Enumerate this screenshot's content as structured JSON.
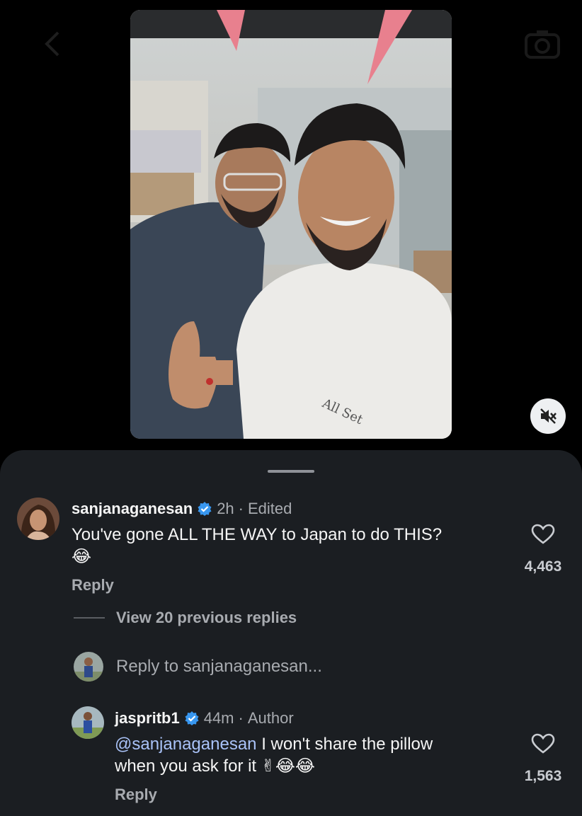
{
  "comments": [
    {
      "username": "sanjanaganesan",
      "verified": true,
      "time": "2h",
      "status": "Edited",
      "text_line1": "You've gone ALL THE WAY to Japan to do THIS?",
      "text_line2_emoji": "😂",
      "reply_label": "Reply",
      "likes": "4,463"
    },
    {
      "username": "jaspritb1",
      "verified": true,
      "time": "44m",
      "status": "Author",
      "mention": "@sanjanaganesan",
      "text_line1_rest": " I won't share the pillow",
      "text_line2": "when you ask for it ",
      "text_line2_emoji": "✌😂😂",
      "reply_label": "Reply",
      "likes": "1,563"
    }
  ],
  "thread": {
    "view_previous": "View 20 previous replies",
    "reply_placeholder": "Reply to sanjanaganesan..."
  },
  "separator": "·",
  "icons": {
    "verified": "verified-badge-icon",
    "like": "heart-icon",
    "mute": "speaker-muted-icon",
    "back": "chevron-left-icon",
    "camera": "camera-icon"
  },
  "colors": {
    "sheet_bg": "#1b1e22",
    "verified_blue": "#3897f0",
    "mention": "#a9c2f7"
  }
}
